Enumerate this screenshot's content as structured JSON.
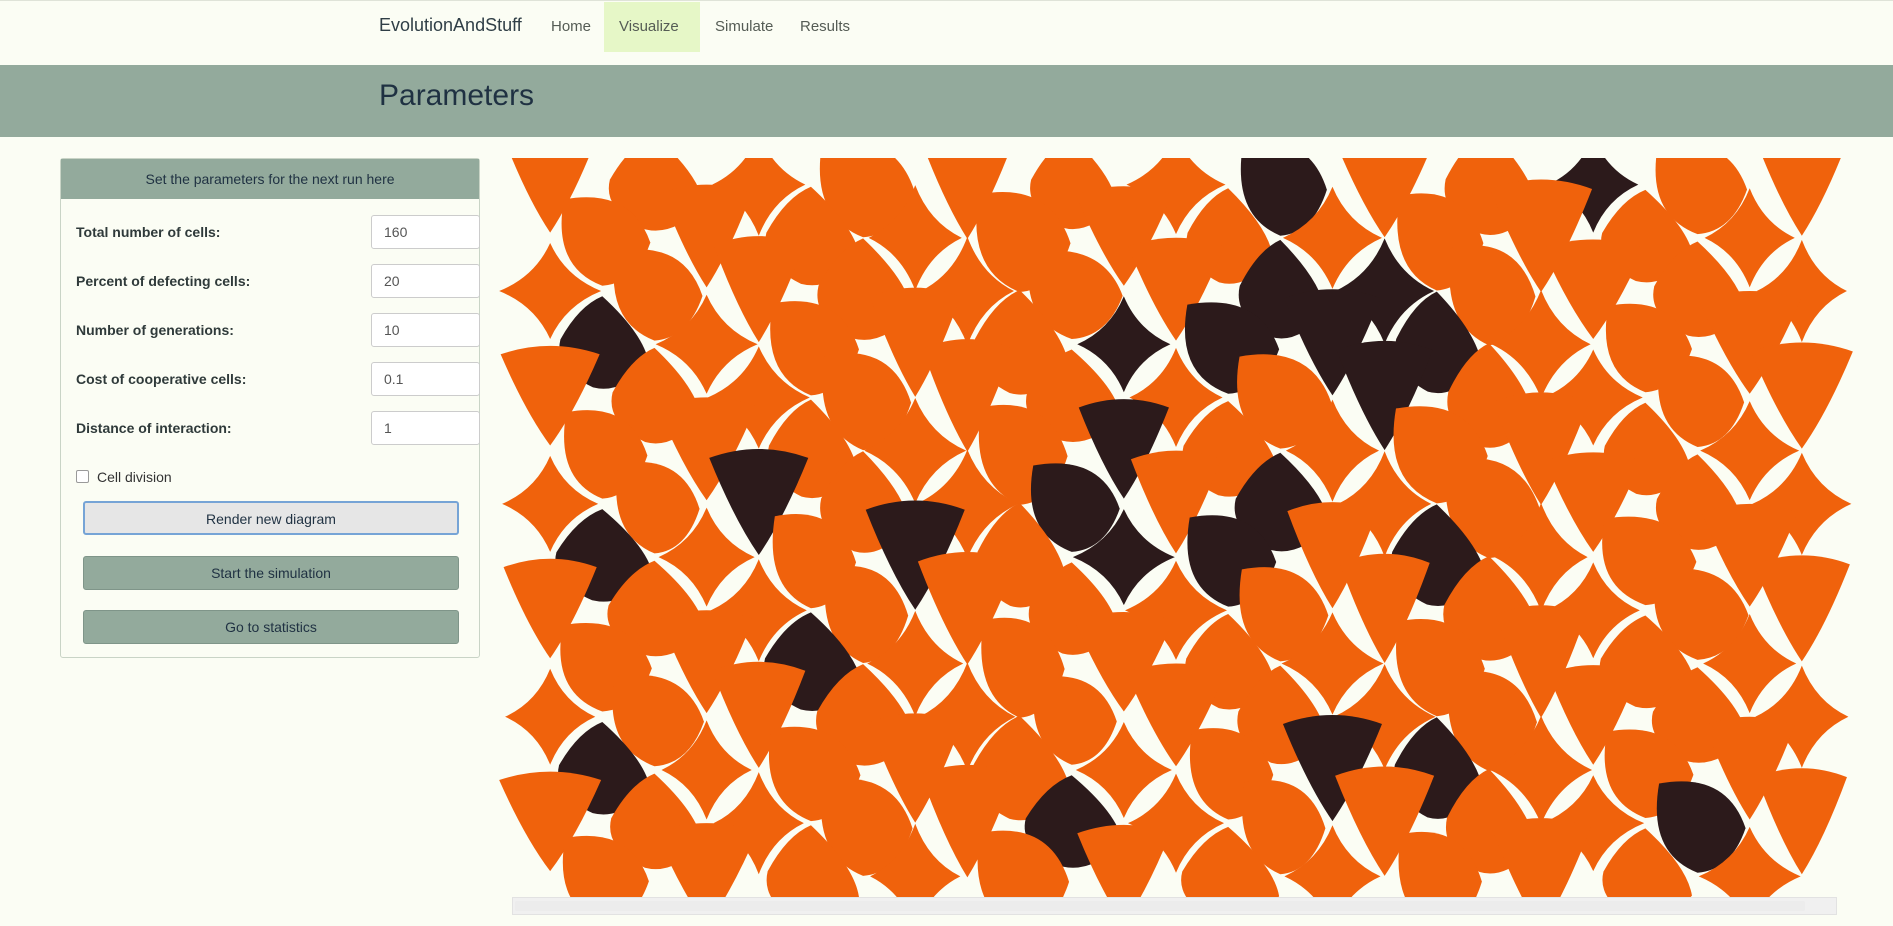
{
  "nav": {
    "brand": "EvolutionAndStuff",
    "items": [
      {
        "label": "Home"
      },
      {
        "label": "Visualize"
      },
      {
        "label": "Simulate"
      },
      {
        "label": "Results"
      }
    ]
  },
  "banner": {
    "title": "Parameters"
  },
  "panel": {
    "heading": "Set the parameters for the next run here",
    "fields": [
      {
        "label": "Total number of cells:",
        "value": "160"
      },
      {
        "label": "Percent of defecting cells:",
        "value": "20"
      },
      {
        "label": "Number of generations:",
        "value": "10"
      },
      {
        "label": "Cost of cooperative cells:",
        "value": "0.1"
      },
      {
        "label": "Distance of interaction:",
        "value": "1"
      }
    ],
    "checkbox_label": "Cell division",
    "checkbox_checked": false,
    "buttons": {
      "render": "Render new diagram",
      "start": "Start the simulation",
      "stats": "Go to statistics"
    }
  },
  "diagram": {
    "cooperator_color": "#f0620c",
    "defector_color": "#2c1a1b"
  }
}
